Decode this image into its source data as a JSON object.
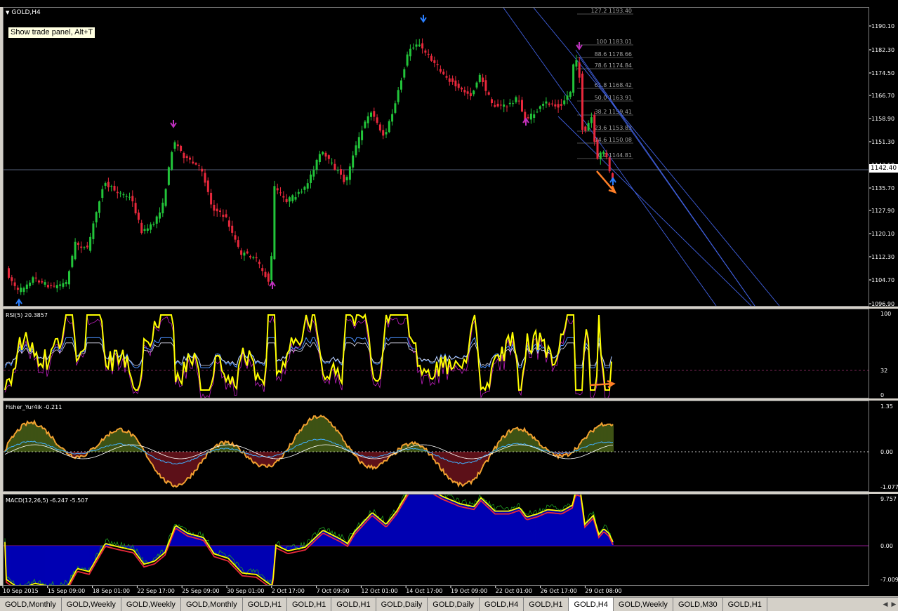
{
  "chart": {
    "symbol_title": "GOLD,H4",
    "tooltip": "Show trade panel, Alt+T",
    "current_price": "1142.40",
    "price_ticks": [
      "1190.10",
      "1182.30",
      "1174.50",
      "1166.70",
      "1158.90",
      "1151.30",
      "1143.50",
      "1135.70",
      "1127.90",
      "1120.10",
      "1112.30",
      "1104.70",
      "1096.90"
    ],
    "fib_levels": [
      {
        "ratio": "127.2",
        "price": "1193.40"
      },
      {
        "ratio": "100",
        "price": "1183.01"
      },
      {
        "ratio": "88.6",
        "price": "1178.66"
      },
      {
        "ratio": "78.6",
        "price": "1174.84"
      },
      {
        "ratio": "61.8",
        "price": "1168.42"
      },
      {
        "ratio": "50.0",
        "price": "1163.91"
      },
      {
        "ratio": "38.2",
        "price": "1159.41"
      },
      {
        "ratio": "23.6",
        "price": "1153.83"
      },
      {
        "ratio": "14.6",
        "price": "1150.08"
      },
      {
        "ratio": "0.0",
        "price": "1144.81"
      }
    ],
    "time_labels": [
      "10 Sep 2015",
      "15 Sep 09:00",
      "18 Sep 01:00",
      "22 Sep 17:00",
      "25 Sep 09:00",
      "30 Sep 01:00",
      "2 Oct 17:00",
      "7 Oct 09:00",
      "12 Oct 01:00",
      "14 Oct 17:00",
      "19 Oct 09:00",
      "22 Oct 01:00",
      "26 Oct 17:00",
      "29 Oct 08:00"
    ]
  },
  "indicators": {
    "rsi": {
      "label": "RSI(5) 20.3857",
      "ticks": [
        "100",
        "32",
        "0"
      ]
    },
    "fisher": {
      "label": "Fisher_Yur4ik -0.211",
      "ticks": [
        "1.35",
        "0.00",
        "-1.077"
      ]
    },
    "macd": {
      "label": "MACD(12,26,5) -6.247 -5.507",
      "ticks": [
        "9.757",
        "0.00",
        "-7.009"
      ]
    }
  },
  "colors": {
    "bull": "#22c43a",
    "bear": "#e8283c",
    "rsi": "#ffff00",
    "fib": "#a0a0a0",
    "channel": "#4060e0",
    "arrow": "#ff7f27",
    "macd_hist": "#0000e0"
  },
  "tabs": [
    "GOLD,Monthly",
    "GOLD,Weekly",
    "GOLD,Weekly",
    "GOLD,Monthly",
    "GOLD,H1",
    "GOLD,H1",
    "GOLD,H1",
    "GOLD,Daily",
    "GOLD,Daily",
    "GOLD,H4",
    "GOLD,H1",
    "GOLD,H4",
    "GOLD,Weekly",
    "GOLD,M30",
    "GOLD,H1"
  ],
  "active_tab": 11
}
